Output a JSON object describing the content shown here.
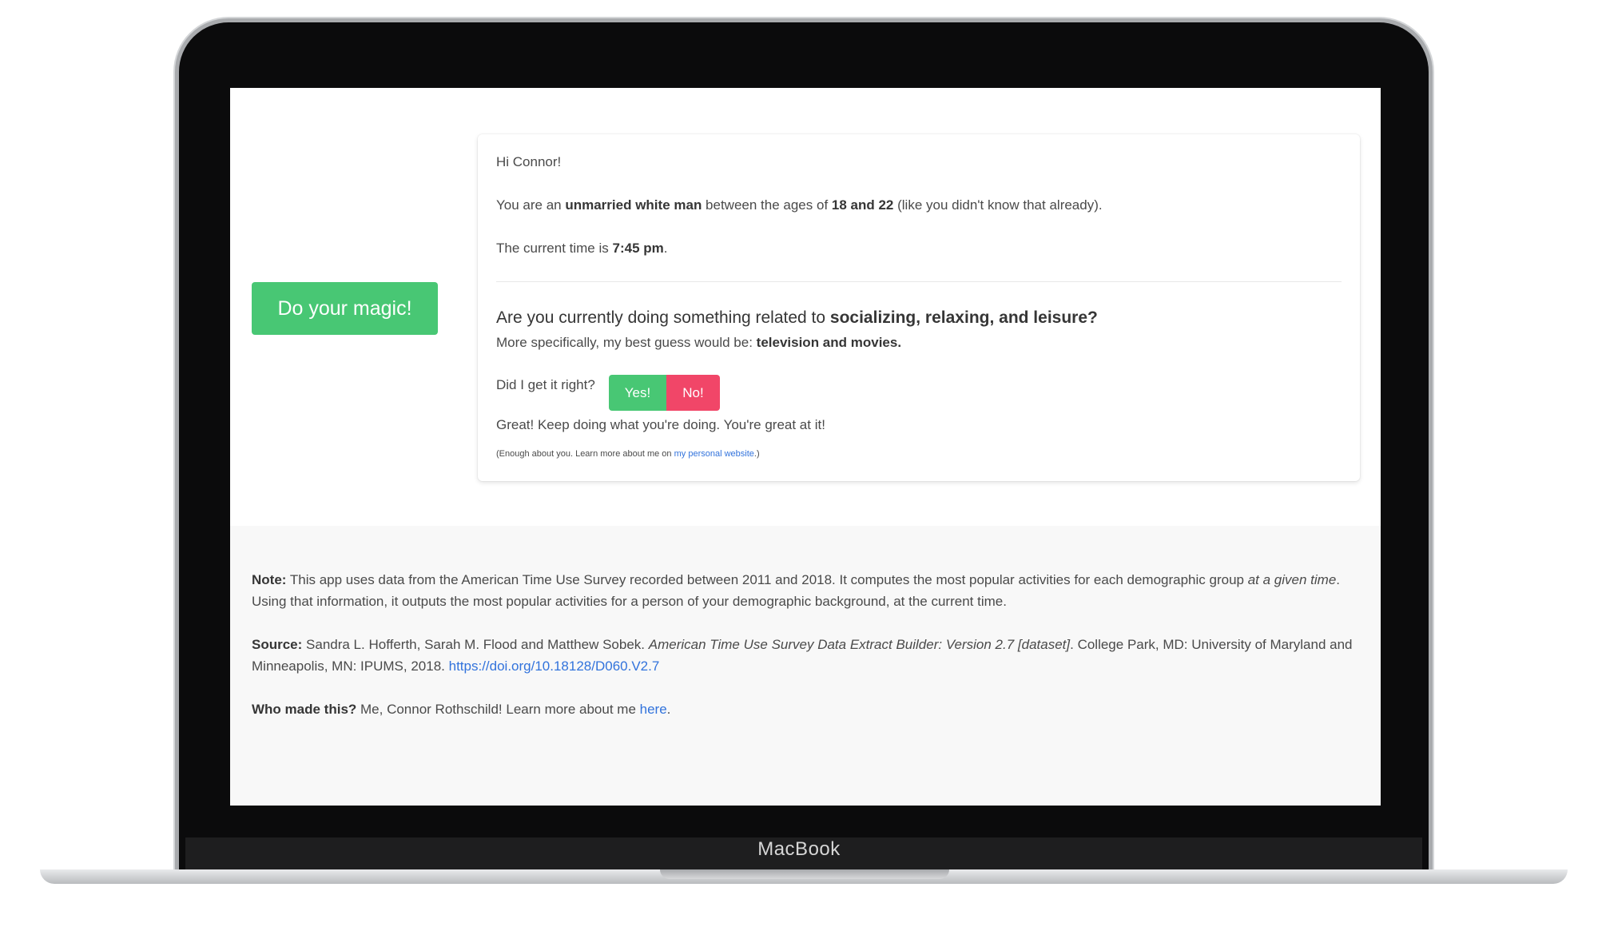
{
  "device": {
    "brand": "MacBook"
  },
  "app": {
    "magic_button": "Do your magic!",
    "card": {
      "greeting": "Hi Connor!",
      "line2_pre": "You are an ",
      "line2_bold1": "unmarried white man",
      "line2_mid": " between the ages of ",
      "line2_bold2": "18 and 22",
      "line2_post": " (like you didn't know that already).",
      "time_pre": "The current time is ",
      "time_value": "7:45 pm",
      "time_post": ".",
      "question_pre": "Are you currently doing something related to ",
      "question_bold": "socializing, relaxing, and leisure?",
      "guess_pre": "More specifically, my best guess would be: ",
      "guess_bold": "television and movies.",
      "check_prompt": "Did I get it right?",
      "yes_label": "Yes!",
      "no_label": "No!",
      "feedback": "Great! Keep doing what you're doing. You're great at it!",
      "more_pre": "(Enough about you. Learn more about me on ",
      "more_link": "my personal website",
      "more_post": ".)"
    },
    "footer": {
      "note_label": "Note:",
      "note_text1": " This app uses data from the American Time Use Survey recorded between 2011 and 2018. It computes the most popular activities for each demographic group ",
      "note_italic": "at a given time",
      "note_text2": ". Using that information, it outputs the most popular activities for a person of your demographic background, at the current time.",
      "source_label": "Source:",
      "source_text1": " Sandra L. Hofferth, Sarah M. Flood and Matthew Sobek. ",
      "source_italic": "American Time Use Survey Data Extract Builder: Version 2.7 [dataset]",
      "source_text2": ". College Park, MD: University of Maryland and Minneapolis, MN: IPUMS, 2018. ",
      "source_link": "https://doi.org/10.18128/D060.V2.7",
      "who_label": "Who made this?",
      "who_text": " Me, Connor Rothschild! Learn more about me ",
      "who_link": "here",
      "who_post": "."
    }
  },
  "colors": {
    "primary_green": "#48c774",
    "danger_red": "#f14668",
    "link_blue": "#3273dc",
    "footer_bg": "#f8f8f8"
  }
}
